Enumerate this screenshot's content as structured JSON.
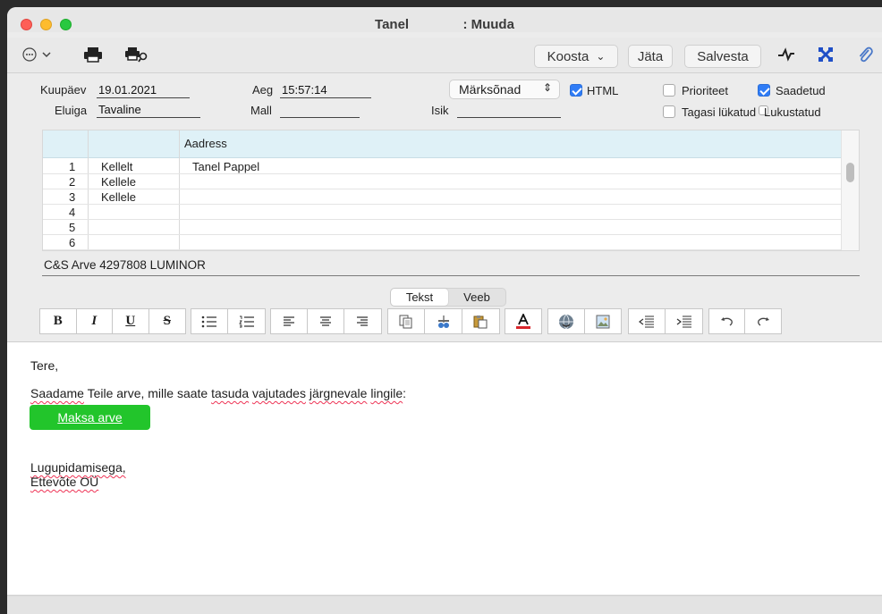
{
  "window": {
    "title_name": "Tanel",
    "title_suffix": ": Muuda"
  },
  "toolbar": {
    "compose_label": "Koosta",
    "compose_chevron": "⌄",
    "keep_label": "Jäta",
    "save_label": "Salvesta"
  },
  "form": {
    "date_label": "Kuupäev",
    "date_value": "19.01.2021",
    "time_label": "Aeg",
    "time_value": "15:57:14",
    "keywords_label": "Märksõnad",
    "html_label": "HTML",
    "priority_label": "Prioriteet",
    "sent_label": "Saadetud",
    "lifetime_label": "Eluiga",
    "lifetime_value": "Tavaline",
    "template_label": "Mall",
    "template_value": "",
    "person_label": "Isik",
    "person_value": "",
    "return_receipt_label": "Tagasi lükatud",
    "locked_label": "Lukustatud"
  },
  "checkboxes": {
    "html": true,
    "priority": false,
    "sent": true,
    "return_receipt": false,
    "locked": false
  },
  "recipients": {
    "header_address": "Aadress",
    "rows": [
      {
        "num": "1",
        "type": "Kellelt",
        "address": "Tanel Pappel"
      },
      {
        "num": "2",
        "type": "Kellele",
        "address": ""
      },
      {
        "num": "3",
        "type": "Kellele",
        "address": ""
      },
      {
        "num": "4",
        "type": "",
        "address": ""
      },
      {
        "num": "5",
        "type": "",
        "address": ""
      },
      {
        "num": "6",
        "type": "",
        "address": ""
      }
    ]
  },
  "subject": "C&S Arve 4297808 LUMINOR",
  "view_tabs": [
    "Tekst",
    "Veeb"
  ],
  "format_toolbar": {
    "bold": "B",
    "italic": "I",
    "underline": "U",
    "strike": "S"
  },
  "body": {
    "greeting": "Tere,",
    "line1": "Saadame Teile arve, mille saate tasuda vajutades järgnevale lingile:",
    "button_label": "Maksa arve",
    "closing": "Lugupidamisega,",
    "company": "Ettevõte OÜ"
  },
  "colors": {
    "pay_button": "#22c52b",
    "checkbox_accent": "#2f7cf6",
    "table_header": "#dff1f7"
  }
}
